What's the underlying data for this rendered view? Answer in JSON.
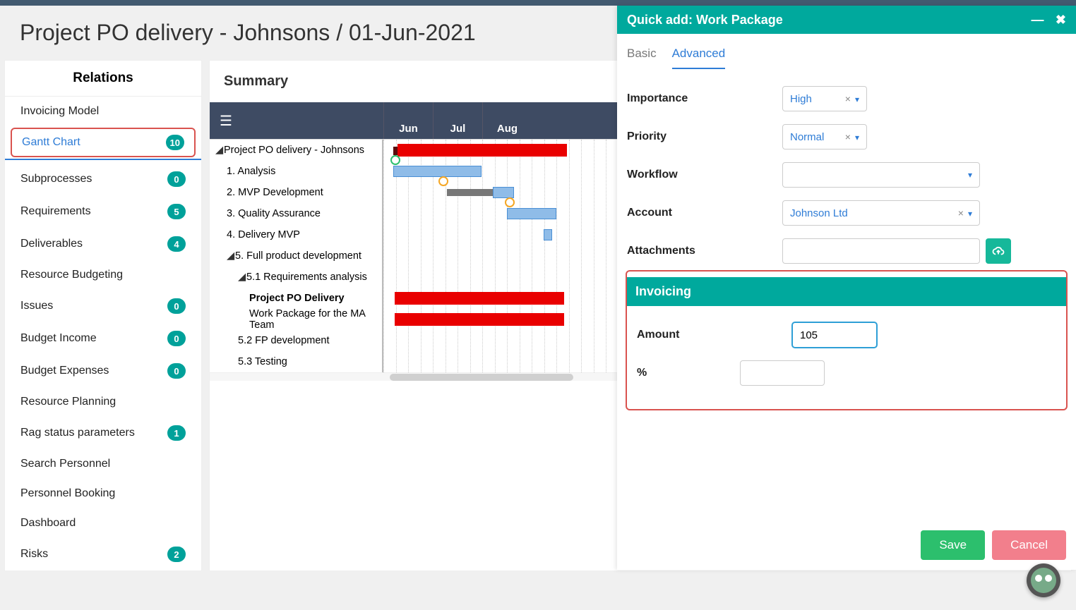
{
  "page": {
    "title": "Project PO delivery - Johnsons / 01-Jun-2021"
  },
  "sidebar": {
    "title": "Relations",
    "items": [
      {
        "label": "Invoicing Model",
        "badge": null
      },
      {
        "label": "Gantt Chart",
        "badge": "10",
        "active": true
      },
      {
        "label": "Subprocesses",
        "badge": "0"
      },
      {
        "label": "Requirements",
        "badge": "5"
      },
      {
        "label": "Deliverables",
        "badge": "4"
      },
      {
        "label": "Resource Budgeting",
        "badge": null
      },
      {
        "label": "Issues",
        "badge": "0"
      },
      {
        "label": "Budget Income",
        "badge": "0"
      },
      {
        "label": "Budget Expenses",
        "badge": "0"
      },
      {
        "label": "Resource Planning",
        "badge": null
      },
      {
        "label": "Rag status parameters",
        "badge": "1"
      },
      {
        "label": "Search Personnel",
        "badge": null
      },
      {
        "label": "Personnel Booking",
        "badge": null
      },
      {
        "label": "Dashboard",
        "badge": null
      },
      {
        "label": "Risks",
        "badge": "2"
      }
    ]
  },
  "content": {
    "title": "Summary",
    "months": [
      "Jun",
      "Jul",
      "Aug"
    ],
    "tree": [
      {
        "label": "Project PO delivery - Johnsons",
        "indent": 0,
        "expand": true
      },
      {
        "label": "1. Analysis",
        "indent": 1
      },
      {
        "label": "2. MVP Development",
        "indent": 1
      },
      {
        "label": "3. Quality Assurance",
        "indent": 1
      },
      {
        "label": "4. Delivery MVP",
        "indent": 1
      },
      {
        "label": "5. Full product development",
        "indent": 1,
        "expand": true
      },
      {
        "label": "5.1 Requirements analysis",
        "indent": 2,
        "expand": true
      },
      {
        "label": "Project PO Delivery",
        "indent": 3,
        "bold": true
      },
      {
        "label": "Work Package for the MA Team",
        "indent": 3
      },
      {
        "label": "5.2 FP development",
        "indent": 2
      },
      {
        "label": "5.3 Testing",
        "indent": 2
      }
    ]
  },
  "panel": {
    "title": "Quick add: Work Package",
    "tabs": {
      "basic": "Basic",
      "advanced": "Advanced"
    },
    "fields": {
      "importance": {
        "label": "Importance",
        "value": "High"
      },
      "priority": {
        "label": "Priority",
        "value": "Normal"
      },
      "workflow": {
        "label": "Workflow",
        "value": ""
      },
      "account": {
        "label": "Account",
        "value": "Johnson Ltd"
      },
      "attachments": {
        "label": "Attachments"
      }
    },
    "invoicing": {
      "header": "Invoicing",
      "amount": {
        "label": "Amount",
        "value": "105"
      },
      "pct": {
        "label": "%",
        "value": ""
      }
    },
    "buttons": {
      "save": "Save",
      "cancel": "Cancel"
    }
  }
}
